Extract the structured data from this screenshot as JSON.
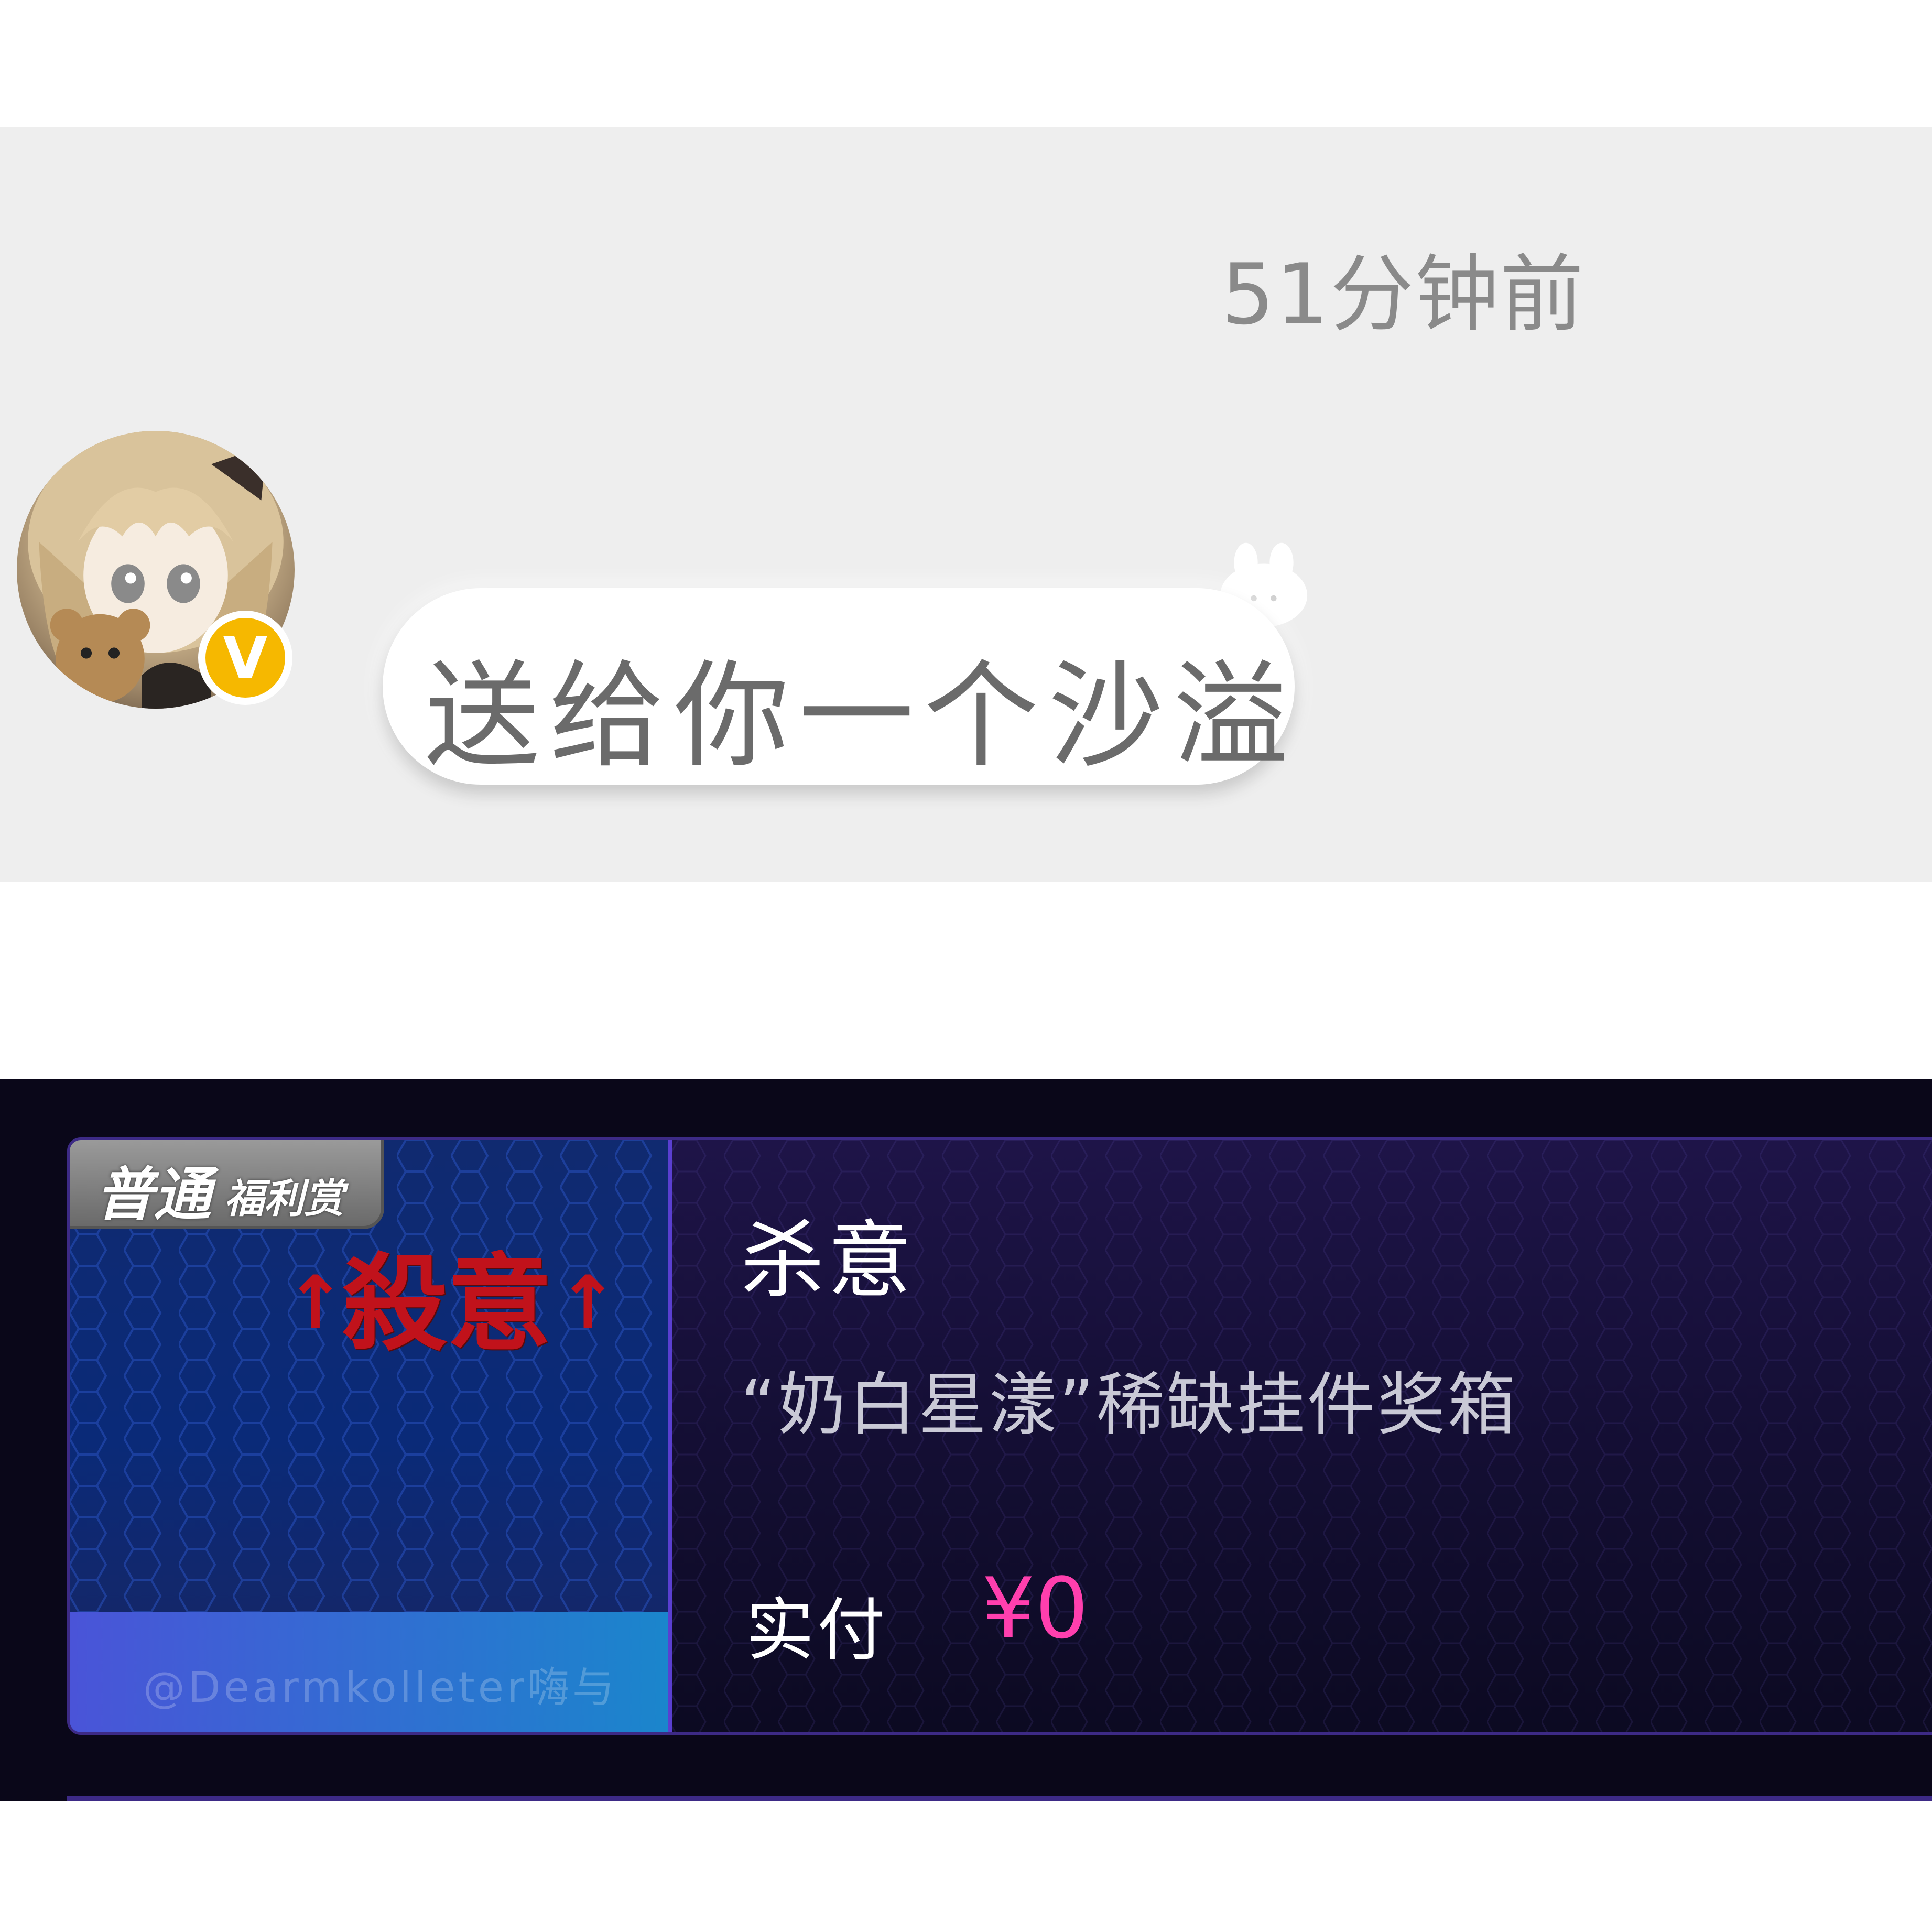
{
  "chat": {
    "timestamp": "51分钟前",
    "message": "送给你一个沙溢",
    "avatar_icon": "anime-girl-avatar",
    "badge_label": "V",
    "badge_color": "#f6b800",
    "sticker_icon": "bunny-sticker-icon"
  },
  "order": {
    "thumbnail": {
      "tag_main": "普通",
      "tag_sub": "福利赏",
      "name": "殺意",
      "arrow": "↑",
      "footer_text": "@Dearmkolleter嗨与"
    },
    "title": "杀意",
    "description": "“奶白星漾”稀缺挂件奖箱",
    "pay_label": "实付",
    "pay_amount": "¥0",
    "accent_color": "#ff3fae"
  }
}
